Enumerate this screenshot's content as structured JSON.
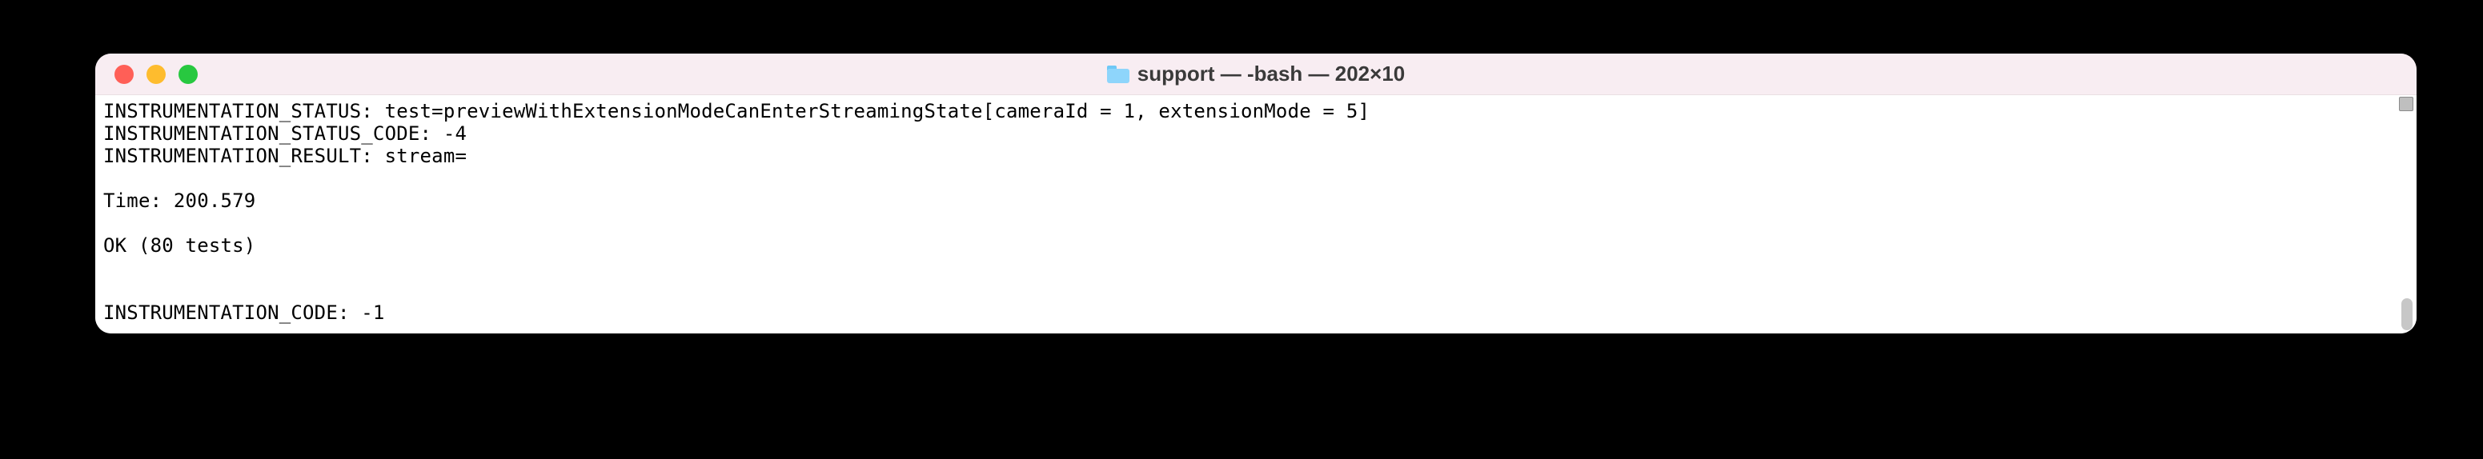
{
  "window": {
    "title": "support — -bash — 202×10"
  },
  "terminal": {
    "lines": {
      "l0": "INSTRUMENTATION_STATUS: test=previewWithExtensionModeCanEnterStreamingState[cameraId = 1, extensionMode = 5]",
      "l1": "INSTRUMENTATION_STATUS_CODE: -4",
      "l2": "INSTRUMENTATION_RESULT: stream=",
      "l3": "",
      "l4": "Time: 200.579",
      "l5": "",
      "l6": "OK (80 tests)",
      "l7": "",
      "l8": "",
      "l9": "INSTRUMENTATION_CODE: -1"
    }
  }
}
